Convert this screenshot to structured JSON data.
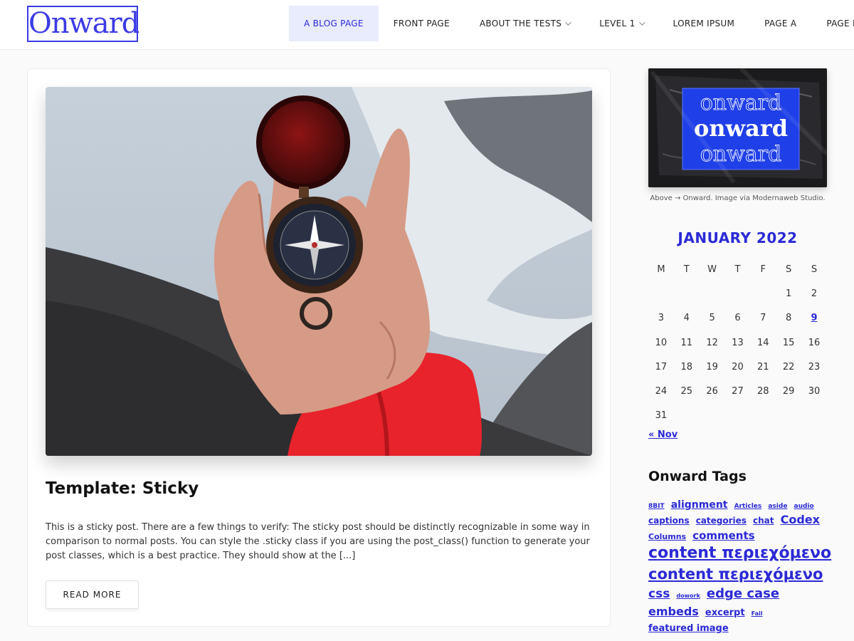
{
  "header": {
    "logo": "Onward",
    "nav": [
      {
        "label": "A BLOG PAGE",
        "active": true,
        "dropdown": false
      },
      {
        "label": "FRONT PAGE",
        "active": false,
        "dropdown": false
      },
      {
        "label": "ABOUT THE TESTS",
        "active": false,
        "dropdown": true
      },
      {
        "label": "LEVEL 1",
        "active": false,
        "dropdown": true
      },
      {
        "label": "LOREM IPSUM",
        "active": false,
        "dropdown": false
      },
      {
        "label": "PAGE A",
        "active": false,
        "dropdown": false
      },
      {
        "label": "PAGE B",
        "active": false,
        "dropdown": false
      }
    ]
  },
  "post": {
    "title": "Template: Sticky",
    "excerpt": "This is a sticky post. There are a few things to verify: The sticky post should be distinctly recognizable in some way in comparison to normal posts. You can style the .sticky class if you are using the post_class() function to generate your post classes, which is a best practice. They should show at the [...]",
    "read_more": "READ MORE"
  },
  "sidebar": {
    "image_text": [
      "onward",
      "onward",
      "onward"
    ],
    "caption": "Above → Onward. Image via Modernaweb Studio.",
    "calendar": {
      "title": "JANUARY 2022",
      "weekdays": [
        "M",
        "T",
        "W",
        "T",
        "F",
        "S",
        "S"
      ],
      "days": [
        "",
        "",
        "",
        "",
        "",
        "1",
        "2",
        "3",
        "4",
        "5",
        "6",
        "7",
        "8",
        "9",
        "10",
        "11",
        "12",
        "13",
        "14",
        "15",
        "16",
        "17",
        "18",
        "19",
        "20",
        "21",
        "22",
        "23",
        "24",
        "25",
        "26",
        "27",
        "28",
        "29",
        "30",
        "31"
      ],
      "highlighted": "9",
      "prev": "« Nov"
    },
    "tags_title": "Onward Tags",
    "tags": [
      {
        "label": "8BIT",
        "size": 9
      },
      {
        "label": "alignment",
        "size": 14
      },
      {
        "label": "Articles",
        "size": 9
      },
      {
        "label": "aside",
        "size": 9
      },
      {
        "label": "audio",
        "size": 9
      },
      {
        "label": "captions",
        "size": 12
      },
      {
        "label": "categories",
        "size": 12
      },
      {
        "label": "chat",
        "size": 12
      },
      {
        "label": "Codex",
        "size": 16
      },
      {
        "label": "Columns",
        "size": 11
      },
      {
        "label": "comments",
        "size": 15
      },
      {
        "label": "content περιεχόμενο",
        "size": 22
      },
      {
        "label": "content περιεχόμενο",
        "size": 21
      },
      {
        "label": "css",
        "size": 17
      },
      {
        "label": "dowork",
        "size": 8
      },
      {
        "label": "edge case",
        "size": 18
      },
      {
        "label": "embeds",
        "size": 16
      },
      {
        "label": "excerpt",
        "size": 13
      },
      {
        "label": "Fail",
        "size": 8
      },
      {
        "label": "featured image",
        "size": 13
      }
    ]
  },
  "colors": {
    "accent": "#2a2ad6",
    "nav_active_bg": "#e8ecfd"
  }
}
